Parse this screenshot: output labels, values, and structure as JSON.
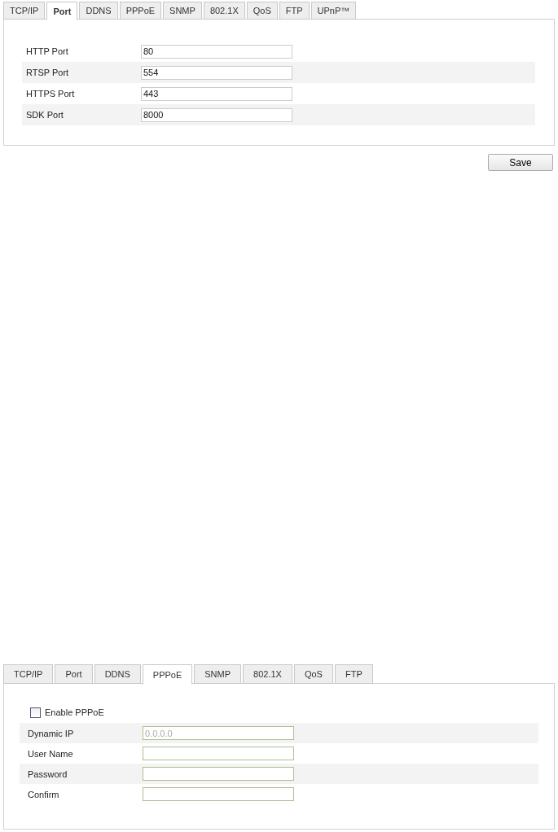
{
  "panels": [
    {
      "tabs": [
        {
          "label": "TCP/IP",
          "selected": false
        },
        {
          "label": "Port",
          "selected": true
        },
        {
          "label": "DDNS",
          "selected": false
        },
        {
          "label": "PPPoE",
          "selected": false
        },
        {
          "label": "SNMP",
          "selected": false
        },
        {
          "label": "802.1X",
          "selected": false
        },
        {
          "label": "QoS",
          "selected": false
        },
        {
          "label": "FTP",
          "selected": false
        },
        {
          "label": "UPnP™",
          "selected": false
        }
      ],
      "rows": [
        {
          "kind": "field",
          "label": "HTTP Port",
          "value": "80"
        },
        {
          "kind": "field",
          "label": "RTSP Port",
          "value": "554"
        },
        {
          "kind": "field",
          "label": "HTTPS Port",
          "value": "443"
        },
        {
          "kind": "field",
          "label": "SDK Port",
          "value": "8000"
        }
      ],
      "save_button": "Save"
    },
    {
      "tabs": [
        {
          "label": "TCP/IP",
          "selected": false
        },
        {
          "label": "Port",
          "selected": false
        },
        {
          "label": "DDNS",
          "selected": false
        },
        {
          "label": "PPPoE",
          "selected": true
        },
        {
          "label": "SNMP",
          "selected": false
        },
        {
          "label": "802.1X",
          "selected": false
        },
        {
          "label": "QoS",
          "selected": false
        },
        {
          "label": "FTP",
          "selected": false
        }
      ],
      "rows": [
        {
          "kind": "checkbox",
          "label": "Enable PPPoE",
          "checked": false
        },
        {
          "kind": "field",
          "label": "Dynamic IP",
          "placeholder": "0.0.0.0"
        },
        {
          "kind": "field",
          "label": "User Name"
        },
        {
          "kind": "field",
          "label": "Password"
        },
        {
          "kind": "field",
          "label": "Confirm"
        }
      ]
    }
  ]
}
